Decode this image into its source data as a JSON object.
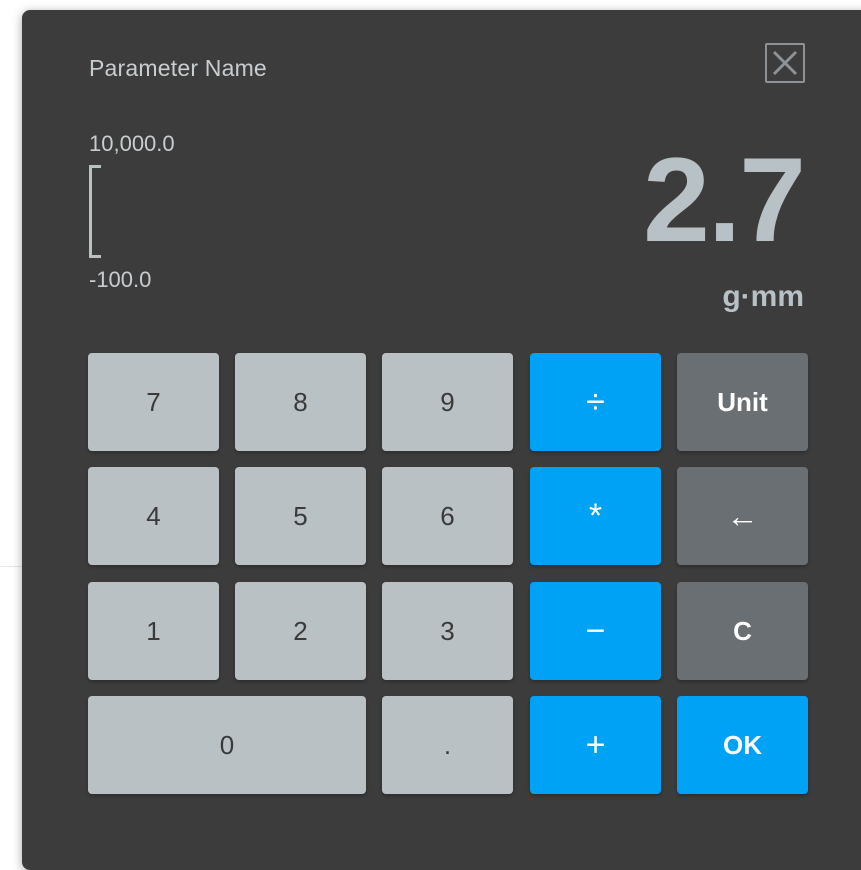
{
  "dialog": {
    "title": "Parameter Name",
    "close_icon": "close-icon"
  },
  "range": {
    "max": "10,000.0",
    "min": "-100.0"
  },
  "display": {
    "value": "2.7",
    "unit": "g·mm"
  },
  "keypad": {
    "seven": "7",
    "eight": "8",
    "nine": "9",
    "divide": "÷",
    "unit": "Unit",
    "four": "4",
    "five": "5",
    "six": "6",
    "multiply": "*",
    "backspace": "←",
    "one": "1",
    "two": "2",
    "three": "3",
    "minus": "−",
    "clear": "C",
    "zero": "0",
    "decimal": ".",
    "plus": "+",
    "ok": "OK"
  },
  "colors": {
    "dialog_bg": "#3c3c3c",
    "number_key": "#b9c1c5",
    "operator_key": "#00a2f5",
    "function_key": "#696f73",
    "display_text": "#b8c1c5"
  }
}
